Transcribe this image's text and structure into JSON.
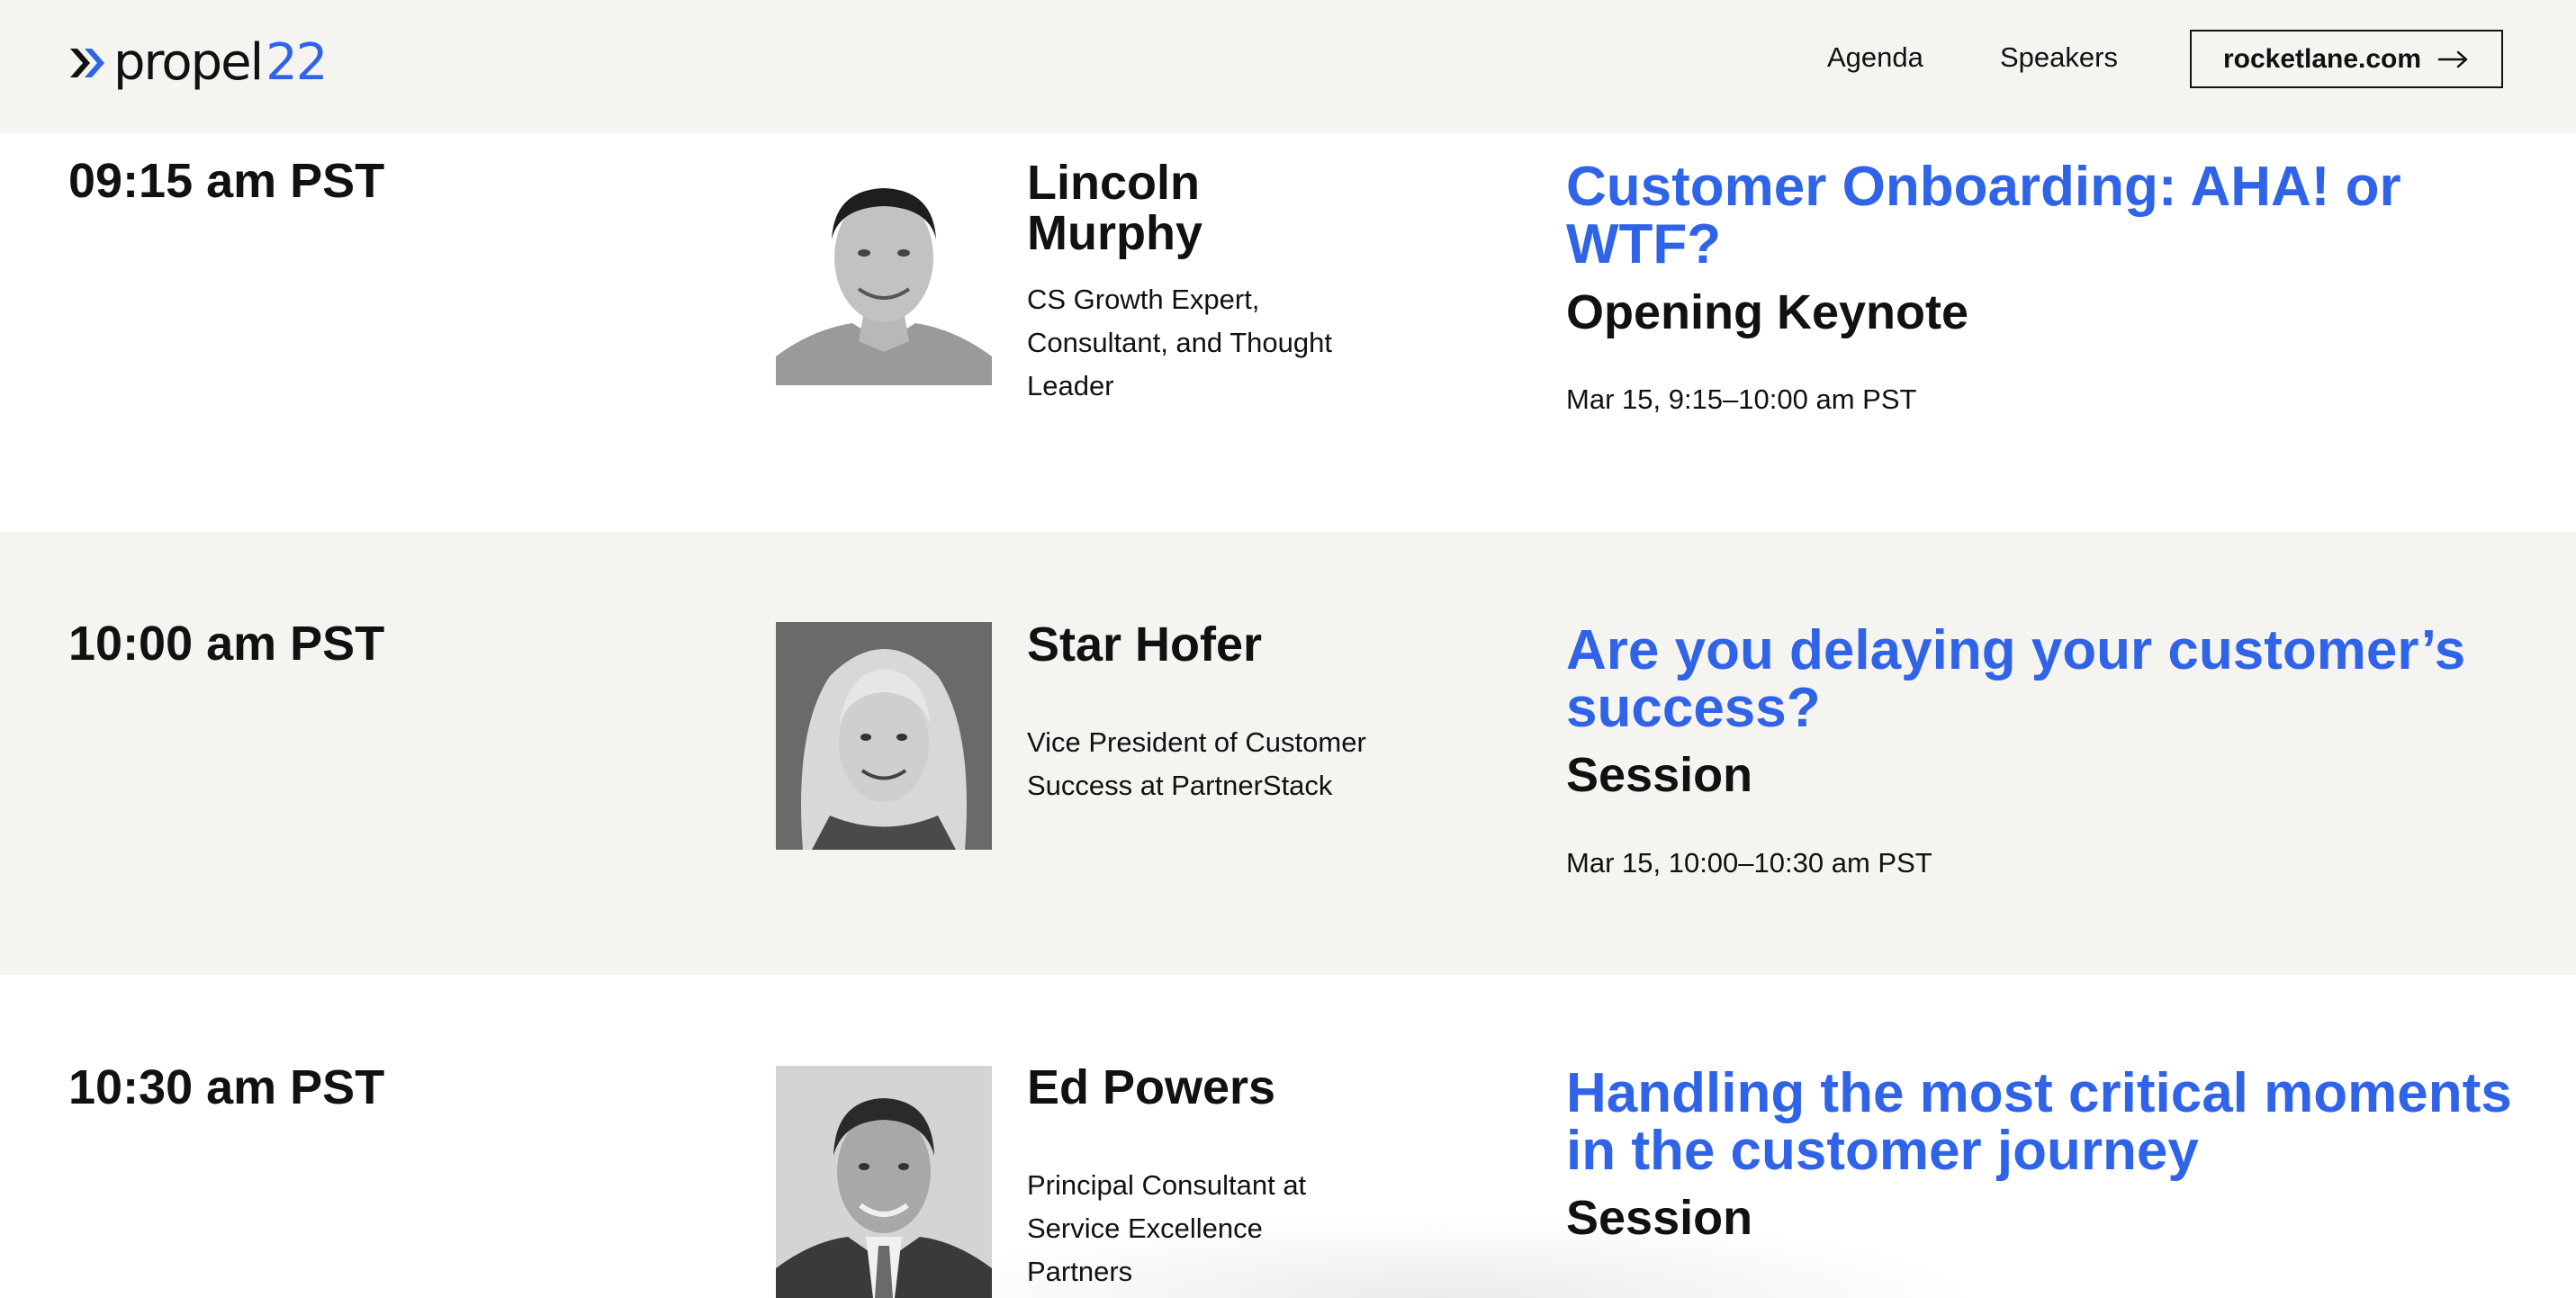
{
  "header": {
    "logo": {
      "word": "propel",
      "number": "22",
      "icon": "double-chevron-icon"
    },
    "nav": [
      {
        "label": "Agenda"
      },
      {
        "label": "Speakers"
      }
    ],
    "cta": {
      "label": "rocketlane.com",
      "icon": "arrow-right-icon"
    }
  },
  "colors": {
    "accent": "#2f63e8",
    "header_bg": "#f5f4f1",
    "alt_row_bg": "#f5f4f1"
  },
  "agenda": [
    {
      "time": "09:15 am PST",
      "speaker": {
        "name": "Lincoln Murphy",
        "role": "CS Growth Expert, Consultant, and Thought Leader",
        "photo": "speaker-photo"
      },
      "session": {
        "title": "Customer Onboarding: AHA! or WTF?",
        "type": "Opening Keynote",
        "date": "Mar 15, 9:15–10:00 am PST"
      }
    },
    {
      "time": "10:00 am PST",
      "speaker": {
        "name": "Star Hofer",
        "role": "Vice President of Customer Success at PartnerStack",
        "photo": "speaker-photo"
      },
      "session": {
        "title": "Are you delaying your customer’s success?",
        "type": "Session",
        "date": "Mar 15, 10:00–10:30 am PST"
      }
    },
    {
      "time": "10:30 am PST",
      "speaker": {
        "name": "Ed Powers",
        "role": "Principal Consultant at Service Excellence Partners",
        "photo": "speaker-photo"
      },
      "session": {
        "title": "Handling the most critical moments in the customer journey",
        "type": "Session"
      }
    }
  ]
}
